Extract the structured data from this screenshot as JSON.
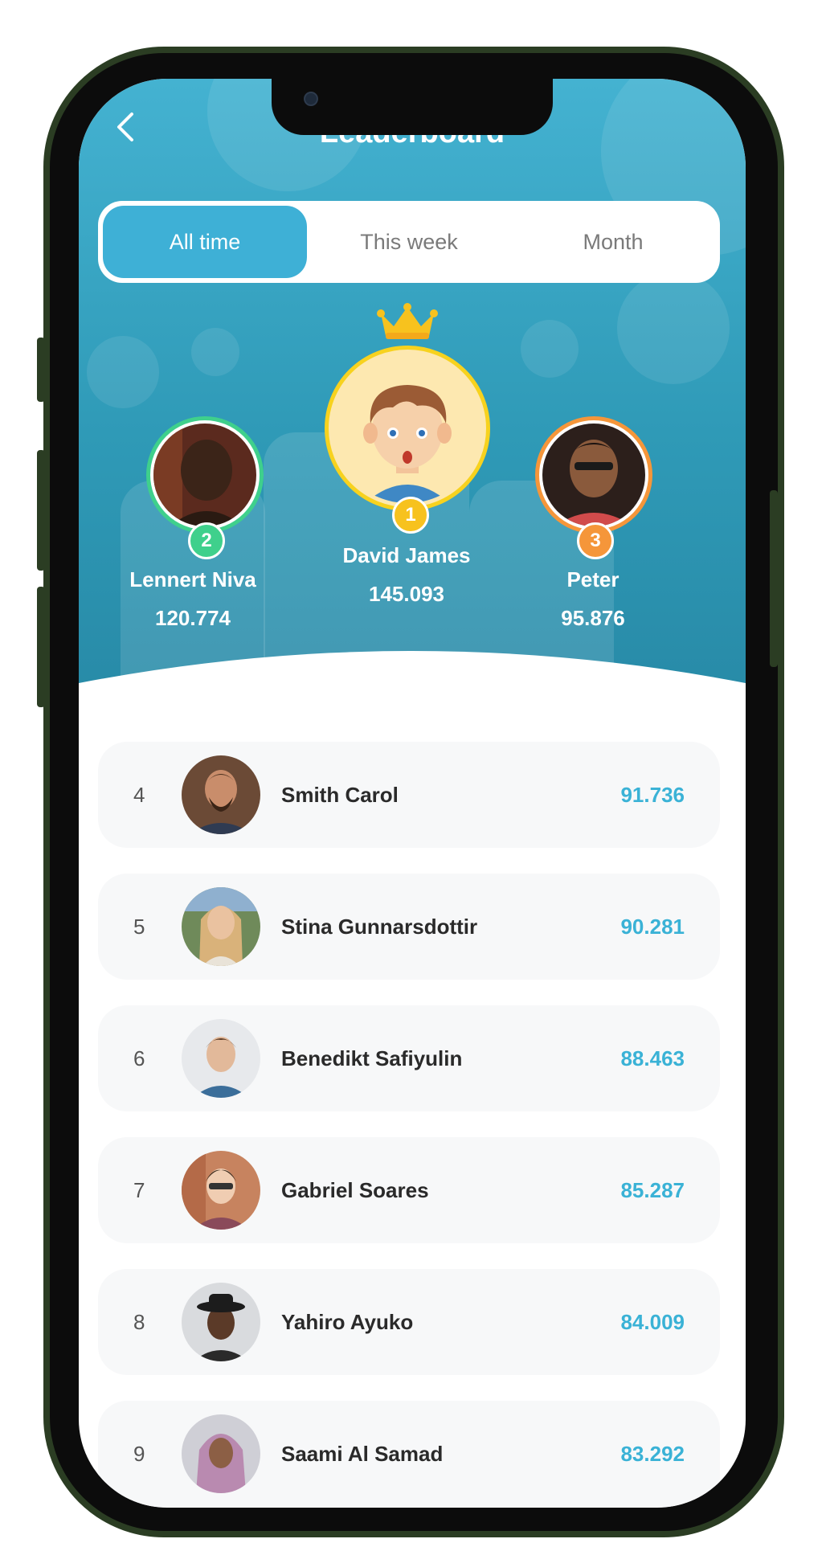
{
  "header": {
    "title": "Leaderboard",
    "back_icon": "chevron-left-icon"
  },
  "tabs": [
    {
      "label": "All time",
      "active": true
    },
    {
      "label": "This week",
      "active": false
    },
    {
      "label": "Month",
      "active": false
    }
  ],
  "podium": {
    "first": {
      "rank": "1",
      "name": "David James",
      "score": "145.093",
      "ring_color": "#f7d21e",
      "icon": "crown-icon"
    },
    "second": {
      "rank": "2",
      "name": "Lennert Niva",
      "score": "120.774",
      "ring_color": "#3fd08c"
    },
    "third": {
      "rank": "3",
      "name": "Peter",
      "score": "95.876",
      "ring_color": "#f5963a"
    }
  },
  "list": [
    {
      "rank": "4",
      "name": "Smith Carol",
      "score": "91.736"
    },
    {
      "rank": "5",
      "name": "Stina Gunnarsdottir",
      "score": "90.281"
    },
    {
      "rank": "6",
      "name": "Benedikt Safiyulin",
      "score": "88.463"
    },
    {
      "rank": "7",
      "name": "Gabriel Soares",
      "score": "85.287"
    },
    {
      "rank": "8",
      "name": "Yahiro Ayuko",
      "score": "84.009"
    },
    {
      "rank": "9",
      "name": "Saami Al Samad",
      "score": "83.292"
    }
  ],
  "colors": {
    "accent": "#3eb0d6",
    "score": "#3ab2d6",
    "hero_top": "#44b2d1",
    "hero_bottom": "#2789a6"
  }
}
